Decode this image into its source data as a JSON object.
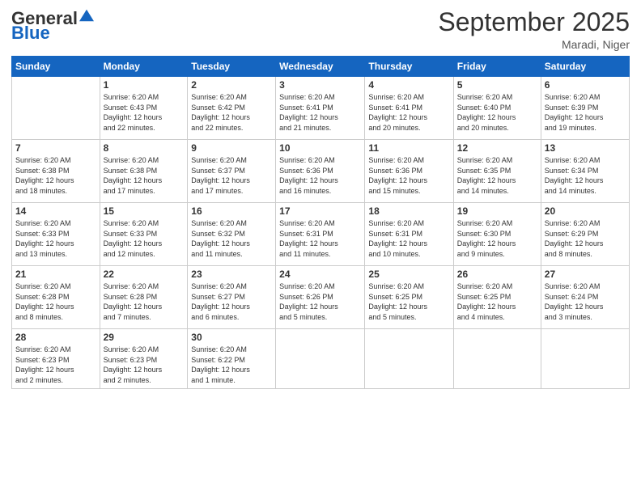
{
  "header": {
    "logo_general": "General",
    "logo_blue": "Blue",
    "title": "September 2025",
    "subtitle": "Maradi, Niger"
  },
  "days_of_week": [
    "Sunday",
    "Monday",
    "Tuesday",
    "Wednesday",
    "Thursday",
    "Friday",
    "Saturday"
  ],
  "weeks": [
    [
      {
        "day": "",
        "info": ""
      },
      {
        "day": "1",
        "info": "Sunrise: 6:20 AM\nSunset: 6:43 PM\nDaylight: 12 hours\nand 22 minutes."
      },
      {
        "day": "2",
        "info": "Sunrise: 6:20 AM\nSunset: 6:42 PM\nDaylight: 12 hours\nand 22 minutes."
      },
      {
        "day": "3",
        "info": "Sunrise: 6:20 AM\nSunset: 6:41 PM\nDaylight: 12 hours\nand 21 minutes."
      },
      {
        "day": "4",
        "info": "Sunrise: 6:20 AM\nSunset: 6:41 PM\nDaylight: 12 hours\nand 20 minutes."
      },
      {
        "day": "5",
        "info": "Sunrise: 6:20 AM\nSunset: 6:40 PM\nDaylight: 12 hours\nand 20 minutes."
      },
      {
        "day": "6",
        "info": "Sunrise: 6:20 AM\nSunset: 6:39 PM\nDaylight: 12 hours\nand 19 minutes."
      }
    ],
    [
      {
        "day": "7",
        "info": "Sunrise: 6:20 AM\nSunset: 6:38 PM\nDaylight: 12 hours\nand 18 minutes."
      },
      {
        "day": "8",
        "info": "Sunrise: 6:20 AM\nSunset: 6:38 PM\nDaylight: 12 hours\nand 17 minutes."
      },
      {
        "day": "9",
        "info": "Sunrise: 6:20 AM\nSunset: 6:37 PM\nDaylight: 12 hours\nand 17 minutes."
      },
      {
        "day": "10",
        "info": "Sunrise: 6:20 AM\nSunset: 6:36 PM\nDaylight: 12 hours\nand 16 minutes."
      },
      {
        "day": "11",
        "info": "Sunrise: 6:20 AM\nSunset: 6:36 PM\nDaylight: 12 hours\nand 15 minutes."
      },
      {
        "day": "12",
        "info": "Sunrise: 6:20 AM\nSunset: 6:35 PM\nDaylight: 12 hours\nand 14 minutes."
      },
      {
        "day": "13",
        "info": "Sunrise: 6:20 AM\nSunset: 6:34 PM\nDaylight: 12 hours\nand 14 minutes."
      }
    ],
    [
      {
        "day": "14",
        "info": "Sunrise: 6:20 AM\nSunset: 6:33 PM\nDaylight: 12 hours\nand 13 minutes."
      },
      {
        "day": "15",
        "info": "Sunrise: 6:20 AM\nSunset: 6:33 PM\nDaylight: 12 hours\nand 12 minutes."
      },
      {
        "day": "16",
        "info": "Sunrise: 6:20 AM\nSunset: 6:32 PM\nDaylight: 12 hours\nand 11 minutes."
      },
      {
        "day": "17",
        "info": "Sunrise: 6:20 AM\nSunset: 6:31 PM\nDaylight: 12 hours\nand 11 minutes."
      },
      {
        "day": "18",
        "info": "Sunrise: 6:20 AM\nSunset: 6:31 PM\nDaylight: 12 hours\nand 10 minutes."
      },
      {
        "day": "19",
        "info": "Sunrise: 6:20 AM\nSunset: 6:30 PM\nDaylight: 12 hours\nand 9 minutes."
      },
      {
        "day": "20",
        "info": "Sunrise: 6:20 AM\nSunset: 6:29 PM\nDaylight: 12 hours\nand 8 minutes."
      }
    ],
    [
      {
        "day": "21",
        "info": "Sunrise: 6:20 AM\nSunset: 6:28 PM\nDaylight: 12 hours\nand 8 minutes."
      },
      {
        "day": "22",
        "info": "Sunrise: 6:20 AM\nSunset: 6:28 PM\nDaylight: 12 hours\nand 7 minutes."
      },
      {
        "day": "23",
        "info": "Sunrise: 6:20 AM\nSunset: 6:27 PM\nDaylight: 12 hours\nand 6 minutes."
      },
      {
        "day": "24",
        "info": "Sunrise: 6:20 AM\nSunset: 6:26 PM\nDaylight: 12 hours\nand 5 minutes."
      },
      {
        "day": "25",
        "info": "Sunrise: 6:20 AM\nSunset: 6:25 PM\nDaylight: 12 hours\nand 5 minutes."
      },
      {
        "day": "26",
        "info": "Sunrise: 6:20 AM\nSunset: 6:25 PM\nDaylight: 12 hours\nand 4 minutes."
      },
      {
        "day": "27",
        "info": "Sunrise: 6:20 AM\nSunset: 6:24 PM\nDaylight: 12 hours\nand 3 minutes."
      }
    ],
    [
      {
        "day": "28",
        "info": "Sunrise: 6:20 AM\nSunset: 6:23 PM\nDaylight: 12 hours\nand 2 minutes."
      },
      {
        "day": "29",
        "info": "Sunrise: 6:20 AM\nSunset: 6:23 PM\nDaylight: 12 hours\nand 2 minutes."
      },
      {
        "day": "30",
        "info": "Sunrise: 6:20 AM\nSunset: 6:22 PM\nDaylight: 12 hours\nand 1 minute."
      },
      {
        "day": "",
        "info": ""
      },
      {
        "day": "",
        "info": ""
      },
      {
        "day": "",
        "info": ""
      },
      {
        "day": "",
        "info": ""
      }
    ]
  ]
}
